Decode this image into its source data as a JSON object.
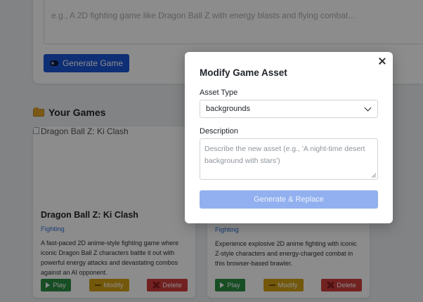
{
  "prompt": {
    "placeholder": "e.g., A 2D fighting game like Dragon Ball Z with energy blasts and flying combat...",
    "generate_label": "Generate Game"
  },
  "games_section": {
    "title": "Your Games"
  },
  "games": [
    {
      "image_alt": "Dragon Ball Z: Ki Clash",
      "title": "Dragon Ball Z: Ki Clash",
      "genre": "Fighting",
      "description": "A fast-paced 2D anime-style fighting game where iconic Dragon Ball Z characters battle it out with powerful energy attacks and devastating combos against an AI opponent.",
      "play_label": "Play",
      "modify_label": "Modify",
      "delete_label": "Delete"
    },
    {
      "genre": "Fighting",
      "description": "Experience explosive 2D anime fighting with iconic Z-style characters and energy-charged combat in this browser-based brawler.",
      "play_label": "Play",
      "modify_label": "Modify",
      "delete_label": "Delete"
    }
  ],
  "modal": {
    "title": "Modify Game Asset",
    "asset_type_label": "Asset Type",
    "asset_type_value": "backgrounds",
    "description_label": "Description",
    "description_placeholder": "Describe the new asset (e.g., 'A night-time desert background with stars')",
    "submit_label": "Generate & Replace"
  },
  "colors": {
    "primary": "#1a55d6",
    "primary_disabled": "#92b0ef",
    "play": "#2a8f42",
    "modify": "#d2a116",
    "delete": "#cf3d3d",
    "genre": "#2f6fd6"
  }
}
